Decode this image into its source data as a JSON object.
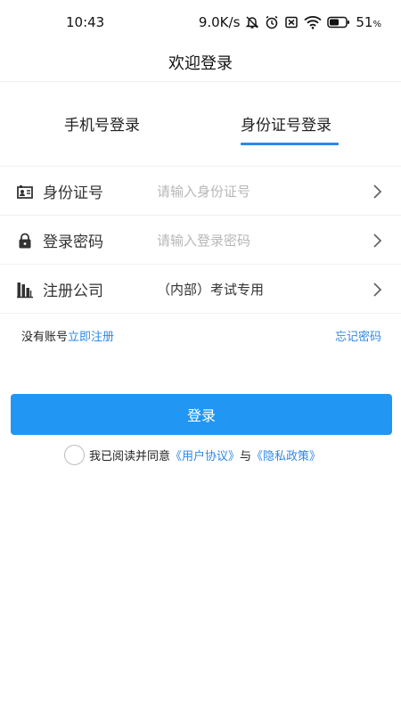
{
  "status_bar": {
    "time": "10:43",
    "network_speed": "9.0K/s",
    "battery": "51",
    "battery_unit": "%",
    "icons": [
      "mute-bell-icon",
      "alarm-icon",
      "sim-off-icon",
      "wifi-icon",
      "battery-icon"
    ]
  },
  "header": {
    "title": "欢迎登录"
  },
  "tabs": [
    {
      "label": "手机号登录",
      "active": false
    },
    {
      "label": "身份证号登录",
      "active": true
    }
  ],
  "form": {
    "id_card": {
      "label": "身份证号",
      "placeholder": "请输入身份证号",
      "icon": "id-card-icon"
    },
    "password": {
      "label": "登录密码",
      "placeholder": "请输入登录密码",
      "icon": "lock-icon"
    },
    "company": {
      "label": "注册公司",
      "value": "（内部）考试专用",
      "icon": "company-icon"
    }
  },
  "links": {
    "no_account": "没有账号",
    "register": "立即注册",
    "forgot_password": "忘记密码"
  },
  "login_button": {
    "label": "登录"
  },
  "agreement": {
    "prefix": "我已阅读并同意",
    "user_agreement": "《用户协议》",
    "and": "与",
    "privacy_policy": "《隐私政策》",
    "checked": false
  },
  "colors": {
    "accent": "#2f88e6",
    "button": "#2196f3",
    "placeholder": "#b7b7b7",
    "divider": "#f1f1f1"
  }
}
